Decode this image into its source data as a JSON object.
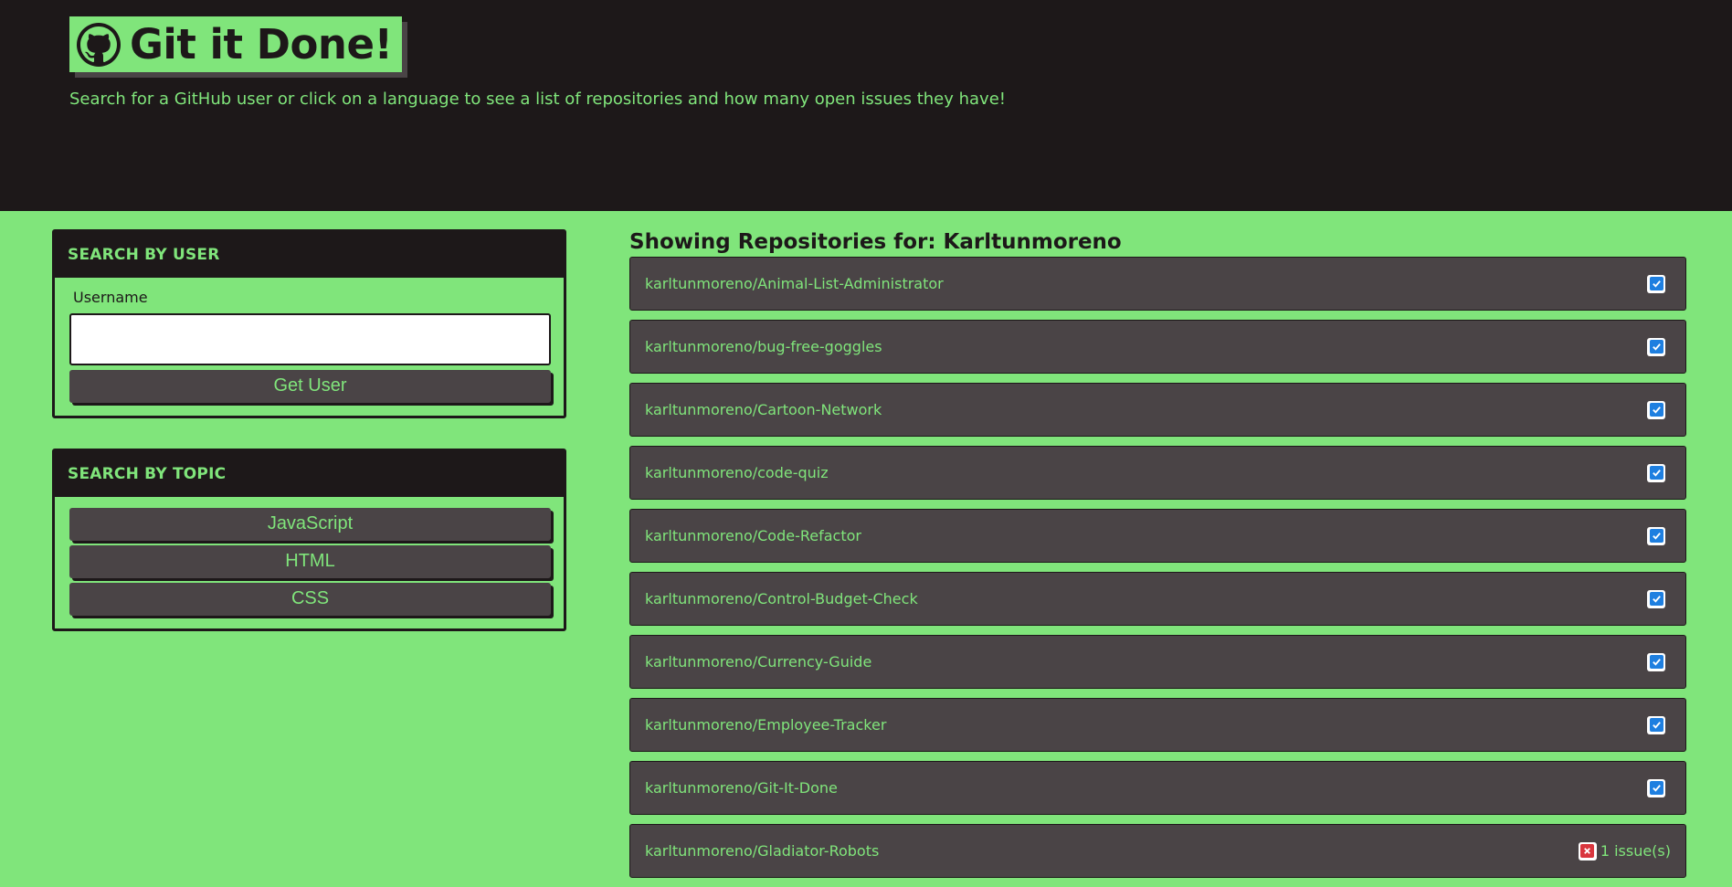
{
  "header": {
    "logo_text": "Git it Done!",
    "subtitle": "Search for a GitHub user or click on a language to see a list of repositories and how many open issues they have!"
  },
  "user_search": {
    "title": "SEARCH BY USER",
    "username_label": "Username",
    "username_value": "",
    "submit_label": "Get User"
  },
  "topic_search": {
    "title": "SEARCH BY TOPIC",
    "topics": [
      "JavaScript",
      "HTML",
      "CSS"
    ]
  },
  "results": {
    "title": "Showing Repositories for: Karltunmoreno",
    "repos": [
      {
        "name": "karltunmoreno/Animal-List-Administrator",
        "status": "ok",
        "issues": ""
      },
      {
        "name": "karltunmoreno/bug-free-goggles",
        "status": "ok",
        "issues": ""
      },
      {
        "name": "karltunmoreno/Cartoon-Network",
        "status": "ok",
        "issues": ""
      },
      {
        "name": "karltunmoreno/code-quiz",
        "status": "ok",
        "issues": ""
      },
      {
        "name": "karltunmoreno/Code-Refactor",
        "status": "ok",
        "issues": ""
      },
      {
        "name": "karltunmoreno/Control-Budget-Check",
        "status": "ok",
        "issues": ""
      },
      {
        "name": "karltunmoreno/Currency-Guide",
        "status": "ok",
        "issues": ""
      },
      {
        "name": "karltunmoreno/Employee-Tracker",
        "status": "ok",
        "issues": ""
      },
      {
        "name": "karltunmoreno/Git-It-Done",
        "status": "ok",
        "issues": ""
      },
      {
        "name": "karltunmoreno/Gladiator-Robots",
        "status": "issues",
        "issues": "1 issue(s)"
      }
    ]
  },
  "icons": {
    "logo": "github-octocat-icon",
    "ok": "checkbox-checked-icon",
    "issues": "x-mark-icon"
  },
  "colors": {
    "background": "#80e57b",
    "dark": "#1d1819",
    "card_item": "#4a4446",
    "check": "#1e7fe0",
    "error": "#d9363e"
  }
}
